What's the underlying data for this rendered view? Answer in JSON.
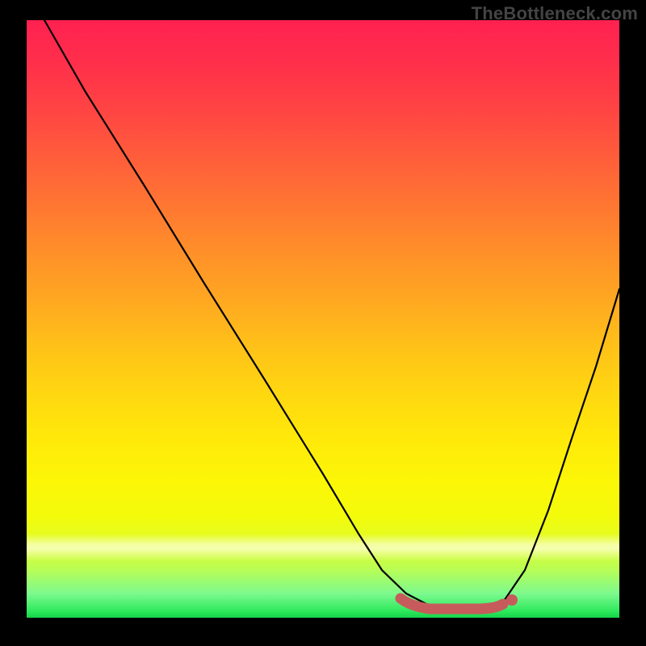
{
  "watermark": "TheBottleneck.com",
  "colors": {
    "background": "#000000",
    "curve_stroke": "#000000",
    "bottom_mark_fill": "#c75b5b",
    "bottom_mark_stroke": "#a84848",
    "gradient_top": "#ff2151",
    "gradient_bottom": "#14d24a"
  },
  "chart_data": {
    "type": "line",
    "title": "",
    "xlabel": "",
    "ylabel": "",
    "xlim": [
      0,
      100
    ],
    "ylim": [
      0,
      100
    ],
    "grid": false,
    "legend": false,
    "series": [
      {
        "name": "bottleneck-curve",
        "x": [
          3,
          10,
          20,
          30,
          40,
          50,
          56,
          60,
          64,
          68,
          72,
          76,
          80,
          84,
          88,
          92,
          96,
          100
        ],
        "y": [
          100,
          88,
          72,
          56,
          40,
          24,
          14,
          8,
          4,
          2,
          1,
          1,
          2,
          8,
          18,
          30,
          42,
          55
        ]
      }
    ],
    "annotations": [
      {
        "name": "sweet-spot-band",
        "x_start": 63,
        "x_end": 82,
        "y": 1.5,
        "note": "flat bottom region highlighted in muted red"
      }
    ]
  }
}
